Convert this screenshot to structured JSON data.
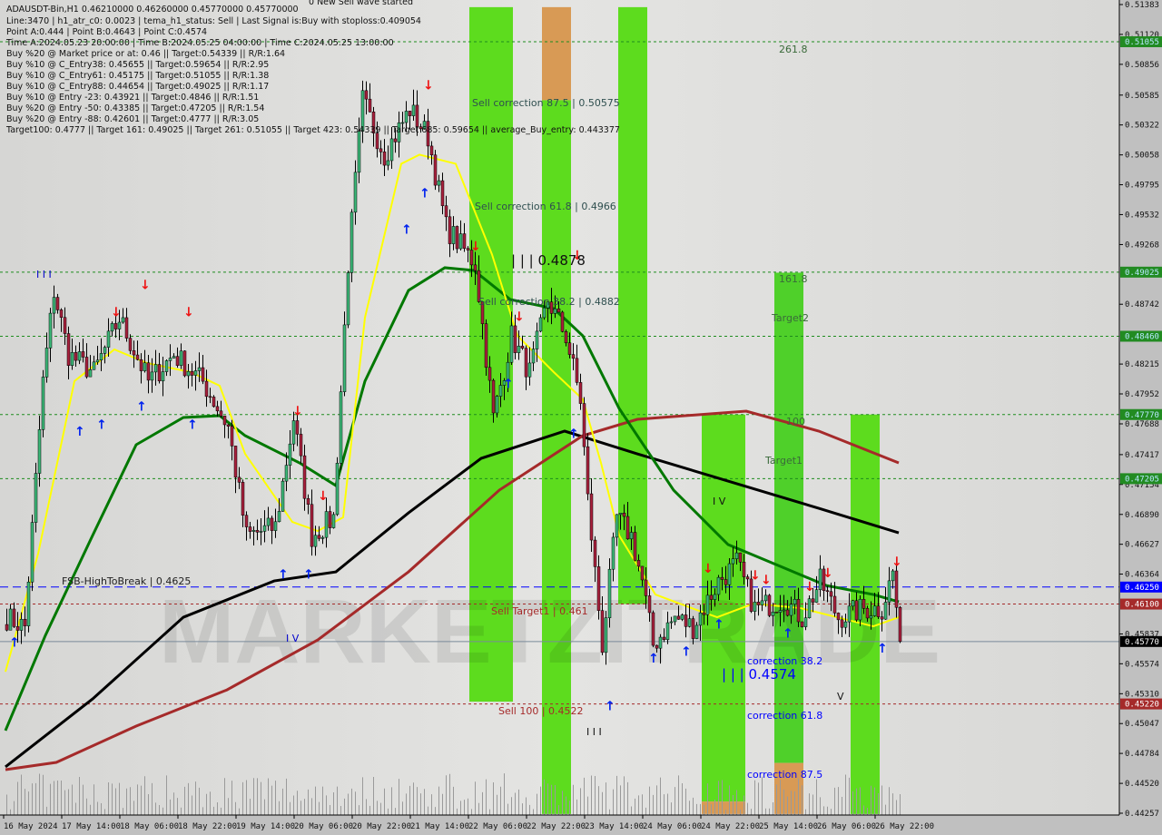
{
  "header": {
    "symbol_line": "ADAUSDT-Bin,H1  0.46210000 0.46260000 0.45770000 0.45770000",
    "lines": [
      "Line:3470 | h1_atr_c0: 0.0023 | tema_h1_status: Sell | Last Signal is:Buy with stoploss:0.409054",
      "Point A:0.444 | Point B:0.4643 | Point C:0.4574",
      "Time A:2024.05.23 20:00:00 | Time B:2024.05.25 04:00:00 | Time C:2024.05.25 13:00:00",
      "Buy %20 @ Market price or at: 0.46 || Target:0.54339 || R/R:1.64",
      "Buy %10 @ C_Entry38: 0.45655 || Target:0.59654 || R/R:2.95",
      "Buy %10 @ C_Entry61: 0.45175 || Target:0.51055 || R/R:1.38",
      "Buy %10 @ C_Entry88: 0.44654 || Target:0.49025 || R/R:1.17",
      "Buy %10 @ Entry -23: 0.43921 || Target:0.4846 || R/R:1.51",
      "Buy %20 @ Entry -50: 0.43385 || Target:0.47205 || R/R:1.54",
      "Buy %20 @ Entry -88: 0.42601 || Target:0.4777 || R/R:3.05",
      "Target100: 0.4777 || Target 161: 0.49025 || Target 261: 0.51055 || Target 423: 0.54339 || Target 685: 0.59654 || average_Buy_entry: 0.443377"
    ],
    "wave_status": "0 New Sell wave started"
  },
  "watermark": "MARKETZITRADE",
  "annotations": {
    "fib_261": "261.8",
    "fib_161": "161.8",
    "target2": "Target2",
    "fib_100": "100",
    "target1": "Target1",
    "sell_corr_875": "Sell correction 87.5 | 0.50575",
    "sell_corr_618": "Sell correction 61.8 | 0.4966",
    "sell_corr_382": "Sell correction 38.2 | 0.4882",
    "wave_top": "| | | 0.4878",
    "fsb": "FSB-HighToBreak | 0.4625",
    "sell_target1": "Sell Target1 | 0.461",
    "sell_100": "Sell 100 | 0.4522",
    "corr_382": "correction 38.2",
    "wave_c": "| | | 0.4574",
    "corr_618": "correction 61.8",
    "corr_875": "correction 87.5",
    "wave_iv_1": "I V",
    "wave_iv_2": "I V",
    "wave_v": "V",
    "wave_iii_1": "I I I",
    "wave_iii_2": "I I I"
  },
  "chart_data": {
    "type": "candlestick",
    "symbol": "ADAUSDT-Bin",
    "timeframe": "H1",
    "ylim": [
      0.44257,
      0.51383
    ],
    "y_ticks": [
      "0.51383",
      "0.51120",
      "0.50856",
      "0.50585",
      "0.50322",
      "0.50058",
      "0.49795",
      "0.49532",
      "0.49268",
      "0.48742",
      "0.48215",
      "0.47952",
      "0.47688",
      "0.47417",
      "0.47154",
      "0.46890",
      "0.46627",
      "0.46364",
      "0.45837",
      "0.45574",
      "0.45310",
      "0.45047",
      "0.44784",
      "0.44520",
      "0.44257"
    ],
    "x_ticks": [
      "16 May 2024",
      "17 May 14:00",
      "18 May 06:00",
      "18 May 22:00",
      "19 May 14:00",
      "20 May 06:00",
      "20 May 22:00",
      "21 May 14:00",
      "22 May 06:00",
      "22 May 22:00",
      "23 May 14:00",
      "24 May 06:00",
      "24 May 22:00",
      "25 May 14:00",
      "26 May 06:00",
      "26 May 22:00"
    ],
    "levels": [
      {
        "price": 0.51055,
        "label": "0.51055",
        "style": "green-dashed",
        "color": "#1e8c1e"
      },
      {
        "price": 0.49025,
        "label": "0.49025",
        "style": "green-dashed",
        "color": "#1e8c1e"
      },
      {
        "price": 0.4846,
        "label": "0.48460",
        "style": "green-dashed",
        "color": "#1e8c1e"
      },
      {
        "price": 0.4777,
        "label": "0.47770",
        "style": "green-dashed",
        "color": "#1e8c1e"
      },
      {
        "price": 0.47205,
        "label": "0.47205",
        "style": "green-dashed",
        "color": "#1e8c1e"
      },
      {
        "price": 0.4625,
        "label": "0.46250",
        "style": "blue-dashed",
        "color": "#0000ff"
      },
      {
        "price": 0.461,
        "label": "0.46100",
        "style": "brown-dashed",
        "color": "#a52a2a"
      },
      {
        "price": 0.4577,
        "label": "0.45770",
        "style": "gray-solid",
        "color": "#000000"
      },
      {
        "price": 0.4522,
        "label": "0.45220",
        "style": "brown-dashed",
        "color": "#a52a2a"
      }
    ],
    "last_price": 0.4577,
    "price_path": [
      [
        0,
        0.4598
      ],
      [
        5,
        0.459
      ],
      [
        10,
        0.4806
      ],
      [
        13,
        0.4886
      ],
      [
        17,
        0.483
      ],
      [
        24,
        0.4814
      ],
      [
        31,
        0.4862
      ],
      [
        39,
        0.4806
      ],
      [
        46,
        0.483
      ],
      [
        54,
        0.4806
      ],
      [
        61,
        0.4766
      ],
      [
        66,
        0.467
      ],
      [
        74,
        0.4678
      ],
      [
        79,
        0.4774
      ],
      [
        84,
        0.467
      ],
      [
        90,
        0.4686
      ],
      [
        94,
        0.491
      ],
      [
        98,
        0.5054
      ],
      [
        104,
        0.5006
      ],
      [
        111,
        0.5046
      ],
      [
        116,
        0.5022
      ],
      [
        121,
        0.4942
      ],
      [
        129,
        0.491
      ],
      [
        134,
        0.4774
      ],
      [
        139,
        0.4846
      ],
      [
        144,
        0.4814
      ],
      [
        149,
        0.4878
      ],
      [
        154,
        0.4846
      ],
      [
        158,
        0.479
      ],
      [
        160,
        0.4702
      ],
      [
        164,
        0.4574
      ],
      [
        168,
        0.4686
      ],
      [
        172,
        0.467
      ],
      [
        175,
        0.463
      ],
      [
        178,
        0.4574
      ],
      [
        184,
        0.4598
      ],
      [
        189,
        0.459
      ],
      [
        196,
        0.463
      ],
      [
        201,
        0.4646
      ],
      [
        206,
        0.4606
      ],
      [
        214,
        0.4614
      ],
      [
        219,
        0.4598
      ],
      [
        224,
        0.463
      ],
      [
        229,
        0.4598
      ],
      [
        236,
        0.4606
      ],
      [
        241,
        0.4606
      ],
      [
        244,
        0.4638
      ],
      [
        246,
        0.4577
      ]
    ],
    "moving_averages": [
      {
        "color": "#000000",
        "points": [
          [
            0,
            0.44665
          ],
          [
            24,
            0.45264
          ],
          [
            49,
            0.45984
          ],
          [
            74,
            0.46304
          ],
          [
            91,
            0.46384
          ],
          [
            111,
            0.46904
          ],
          [
            131,
            0.47384
          ],
          [
            154,
            0.47624
          ],
          [
            174,
            0.47424
          ],
          [
            199,
            0.47184
          ],
          [
            224,
            0.46944
          ],
          [
            246,
            0.46728
          ]
        ]
      },
      {
        "color": "#a52a2a",
        "points": [
          [
            0,
            0.44641
          ],
          [
            14,
            0.44705
          ],
          [
            36,
            0.45025
          ],
          [
            61,
            0.45344
          ],
          [
            86,
            0.45784
          ],
          [
            111,
            0.46384
          ],
          [
            136,
            0.47104
          ],
          [
            159,
            0.47584
          ],
          [
            174,
            0.47728
          ],
          [
            204,
            0.478
          ],
          [
            224,
            0.47624
          ],
          [
            246,
            0.47344
          ]
        ]
      },
      {
        "color": "#007800",
        "points": [
          [
            0,
            0.44985
          ],
          [
            11,
            0.45824
          ],
          [
            24,
            0.46704
          ],
          [
            36,
            0.47504
          ],
          [
            49,
            0.47744
          ],
          [
            59,
            0.4776
          ],
          [
            66,
            0.47584
          ],
          [
            81,
            0.47344
          ],
          [
            91,
            0.47144
          ],
          [
            99,
            0.48064
          ],
          [
            111,
            0.48864
          ],
          [
            121,
            0.49064
          ],
          [
            129,
            0.4904
          ],
          [
            139,
            0.48784
          ],
          [
            151,
            0.48704
          ],
          [
            159,
            0.48464
          ],
          [
            169,
            0.47824
          ],
          [
            184,
            0.47104
          ],
          [
            199,
            0.46624
          ],
          [
            214,
            0.46424
          ],
          [
            226,
            0.46264
          ],
          [
            239,
            0.46184
          ],
          [
            246,
            0.4612
          ]
        ]
      },
      {
        "color": "#ffff00",
        "points": [
          [
            0,
            0.45504
          ],
          [
            9,
            0.46544
          ],
          [
            19,
            0.48064
          ],
          [
            30,
            0.48344
          ],
          [
            39,
            0.48224
          ],
          [
            51,
            0.48144
          ],
          [
            59,
            0.48024
          ],
          [
            66,
            0.47424
          ],
          [
            79,
            0.46824
          ],
          [
            86,
            0.46744
          ],
          [
            93,
            0.46864
          ],
          [
            99,
            0.48624
          ],
          [
            109,
            0.4998
          ],
          [
            114,
            0.5006
          ],
          [
            124,
            0.4998
          ],
          [
            134,
            0.4918
          ],
          [
            141,
            0.48464
          ],
          [
            151,
            0.48144
          ],
          [
            159,
            0.47904
          ],
          [
            164,
            0.47344
          ],
          [
            169,
            0.46704
          ],
          [
            179,
            0.46184
          ],
          [
            189,
            0.46064
          ],
          [
            196,
            0.45984
          ],
          [
            206,
            0.46104
          ],
          [
            219,
            0.46064
          ],
          [
            229,
            0.45984
          ],
          [
            239,
            0.45904
          ],
          [
            246,
            0.45984
          ]
        ]
      }
    ],
    "zones": [
      {
        "bars": [
          128,
          140
        ],
        "from": 0.5136,
        "to": 0.4524,
        "color": "#5ddc1e"
      },
      {
        "bars": [
          148,
          156
        ],
        "from": 0.5136,
        "to": 0.5054,
        "color": "#d89a55"
      },
      {
        "bars": [
          148,
          156
        ],
        "from": 0.5054,
        "to": 0.4425,
        "color": "#5ddc1e"
      },
      {
        "bars": [
          169,
          177
        ],
        "from": 0.5136,
        "to": 0.461,
        "color": "#5ddc1e"
      },
      {
        "bars": [
          192,
          204
        ],
        "from": 0.4777,
        "to": 0.4436,
        "color": "#5ddc1e"
      },
      {
        "bars": [
          192,
          204
        ],
        "from": 0.4436,
        "to": 0.4425,
        "color": "#d89a55"
      },
      {
        "bars": [
          212,
          220
        ],
        "from": 0.4902,
        "to": 0.447,
        "color": "#4fd02a"
      },
      {
        "bars": [
          212,
          220
        ],
        "from": 0.447,
        "to": 0.4425,
        "color": "#d89a55"
      },
      {
        "bars": [
          233,
          241
        ],
        "from": 0.4777,
        "to": 0.4425,
        "color": "#5ddc1e"
      }
    ],
    "signals": [
      {
        "bar": 2,
        "price": 0.4582,
        "type": "buy"
      },
      {
        "bar": 20,
        "price": 0.4768,
        "type": "buy"
      },
      {
        "bar": 26,
        "price": 0.4774,
        "type": "buy"
      },
      {
        "bar": 37,
        "price": 0.479,
        "type": "buy"
      },
      {
        "bar": 51,
        "price": 0.4774,
        "type": "buy"
      },
      {
        "bar": 30,
        "price": 0.4862,
        "type": "sell"
      },
      {
        "bar": 38,
        "price": 0.4886,
        "type": "sell"
      },
      {
        "bar": 50,
        "price": 0.4862,
        "type": "sell"
      },
      {
        "bar": 80,
        "price": 0.4775,
        "type": "sell"
      },
      {
        "bar": 87,
        "price": 0.47,
        "type": "sell"
      },
      {
        "bar": 76,
        "price": 0.4642,
        "type": "buy"
      },
      {
        "bar": 83,
        "price": 0.4642,
        "type": "buy"
      },
      {
        "bar": 110,
        "price": 0.4946,
        "type": "buy"
      },
      {
        "bar": 115,
        "price": 0.4978,
        "type": "buy"
      },
      {
        "bar": 116,
        "price": 0.5062,
        "type": "sell"
      },
      {
        "bar": 129,
        "price": 0.492,
        "type": "sell"
      },
      {
        "bar": 141,
        "price": 0.4858,
        "type": "sell"
      },
      {
        "bar": 157,
        "price": 0.4912,
        "type": "sell"
      },
      {
        "bar": 138,
        "price": 0.481,
        "type": "buy"
      },
      {
        "bar": 156,
        "price": 0.4766,
        "type": "buy"
      },
      {
        "bar": 166,
        "price": 0.4526,
        "type": "buy"
      },
      {
        "bar": 178,
        "price": 0.4568,
        "type": "buy"
      },
      {
        "bar": 187,
        "price": 0.4574,
        "type": "buy"
      },
      {
        "bar": 196,
        "price": 0.4598,
        "type": "buy"
      },
      {
        "bar": 215,
        "price": 0.459,
        "type": "buy"
      },
      {
        "bar": 241,
        "price": 0.4577,
        "type": "buy"
      },
      {
        "bar": 193,
        "price": 0.4636,
        "type": "sell"
      },
      {
        "bar": 206,
        "price": 0.463,
        "type": "sell"
      },
      {
        "bar": 209,
        "price": 0.4626,
        "type": "sell"
      },
      {
        "bar": 221,
        "price": 0.462,
        "type": "sell"
      },
      {
        "bar": 226,
        "price": 0.4632,
        "type": "sell"
      },
      {
        "bar": 245,
        "price": 0.4642,
        "type": "sell"
      }
    ]
  }
}
